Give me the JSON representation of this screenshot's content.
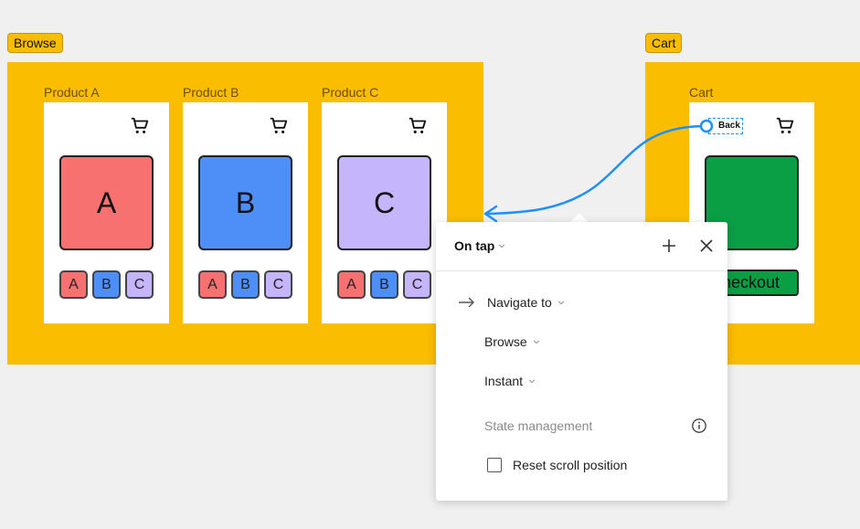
{
  "frames": {
    "browse": {
      "tag": "Browse",
      "cards": [
        {
          "label": "Product A",
          "letter": "A"
        },
        {
          "label": "Product B",
          "letter": "B"
        },
        {
          "label": "Product C",
          "letter": "C"
        }
      ],
      "chips": [
        "A",
        "B",
        "C"
      ]
    },
    "cart": {
      "tag": "Cart",
      "label": "Cart",
      "back": "Back",
      "checkout": "Checkout"
    }
  },
  "interaction_panel": {
    "trigger": "On tap",
    "action": "Navigate to",
    "destination": "Browse",
    "animation": "Instant",
    "section": "State management",
    "checkbox_label": "Reset scroll position"
  },
  "colors": {
    "frame": "#fbbd00",
    "a": "#f87171",
    "b": "#4d8ef7",
    "c": "#c4b5fd",
    "checkout": "#0a9e45",
    "connector": "#1e90ff"
  }
}
